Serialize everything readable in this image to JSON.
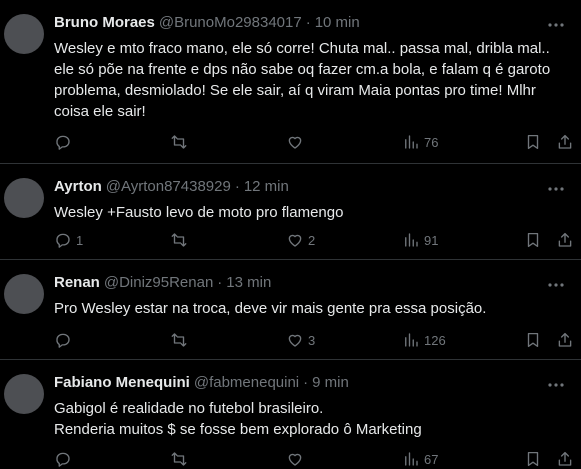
{
  "tweets": [
    {
      "name": "Bruno Moraes",
      "handle": "@BrunoMo29834017",
      "separator": "·",
      "time": "10 min",
      "lines": [
        "Wesley e mto fraco mano, ele só corre! Chuta mal.. passa mal, dribla mal..",
        "ele só põe na frente e dps não sabe oq fazer cm.a bola, e falam q é garoto",
        "problema, desmiolado! Se ele sair, aí q viram Maia pontas pro time! Mlhr",
        "coisa ele sair!"
      ],
      "replies": "",
      "retweets": "",
      "likes": "",
      "views": "76"
    },
    {
      "name": "Ayrton",
      "handle": "@Ayrton87438929",
      "separator": "·",
      "time": "12 min",
      "lines": [
        "Wesley +Fausto levo de moto pro flamengo"
      ],
      "replies": "1",
      "retweets": "",
      "likes": "2",
      "views": "91"
    },
    {
      "name": "Renan",
      "handle": "@Diniz95Renan",
      "separator": "·",
      "time": "13 min",
      "lines": [
        "Pro Wesley estar na troca, deve vir mais gente pra essa posição."
      ],
      "replies": "",
      "retweets": "",
      "likes": "3",
      "views": "126"
    },
    {
      "name": "Fabiano Menequini",
      "handle": "@fabmenequini",
      "separator": "·",
      "time": "9 min",
      "lines": [
        "Gabigol é realidade no futebol brasileiro.",
        "Renderia muitos $ se fosse bem explorado ô Marketing"
      ],
      "replies": "",
      "retweets": "",
      "likes": "",
      "views": "67"
    }
  ],
  "icons": {
    "more": "more-icon",
    "reply": "reply-icon",
    "retweet": "retweet-icon",
    "like": "like-icon",
    "views": "views-icon",
    "bookmark": "bookmark-icon",
    "share": "share-icon"
  },
  "colors": {
    "background": "#000000",
    "text": "#e7e9ea",
    "muted": "#71767b",
    "divider": "#2f3336",
    "avatar": "#4d4f53"
  }
}
